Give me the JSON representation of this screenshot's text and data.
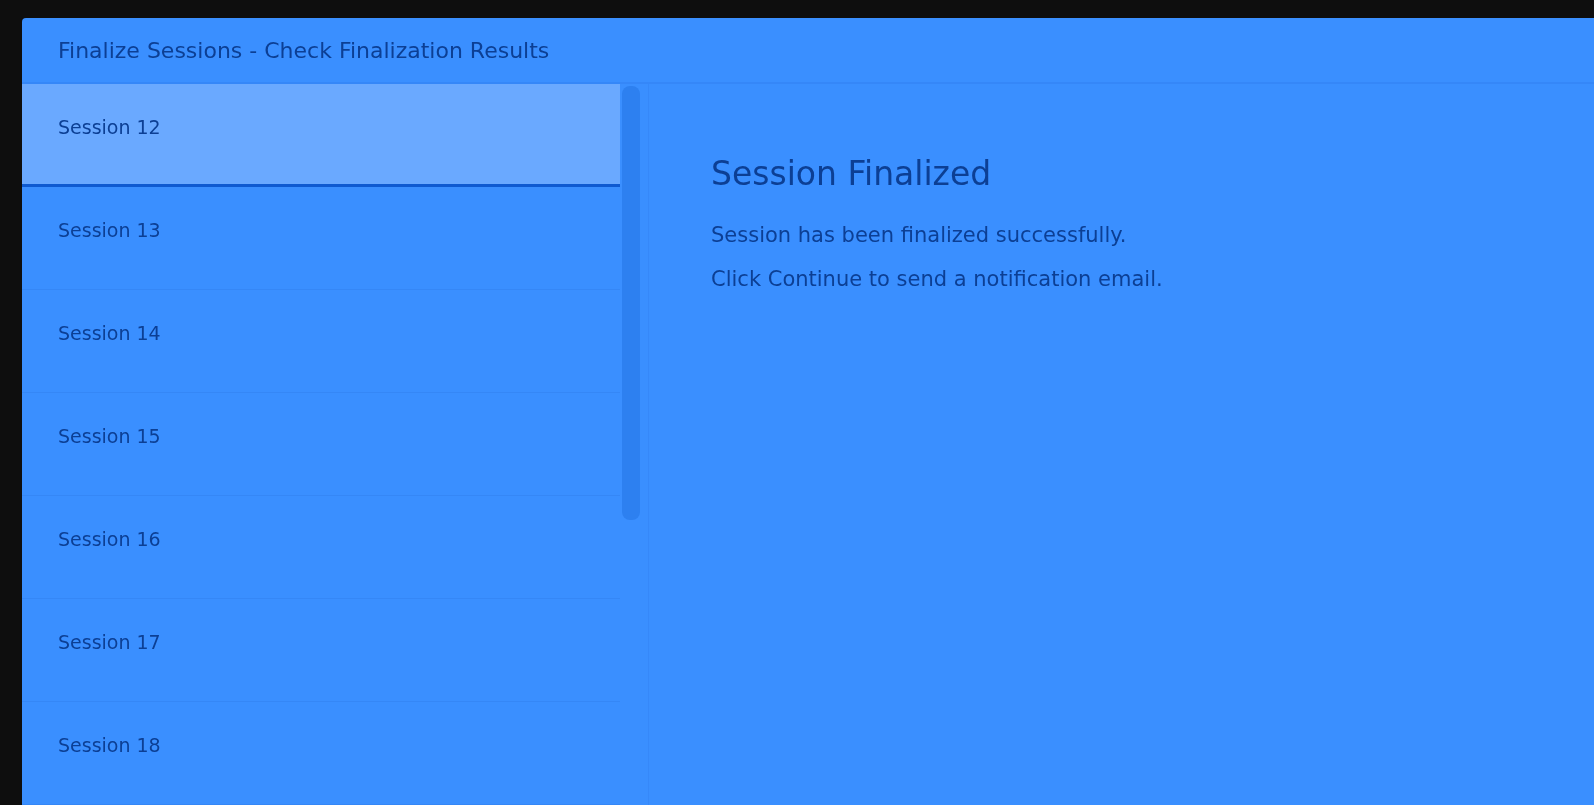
{
  "window": {
    "title": "Finalize Sessions - Check Finalization Results"
  },
  "sessions": [
    {
      "label": "Session 12",
      "selected": true
    },
    {
      "label": "Session 13",
      "selected": false
    },
    {
      "label": "Session 14",
      "selected": false
    },
    {
      "label": "Session 15",
      "selected": false
    },
    {
      "label": "Session 16",
      "selected": false
    },
    {
      "label": "Session 17",
      "selected": false
    },
    {
      "label": "Session 18",
      "selected": false
    }
  ],
  "detail": {
    "heading": "Session Finalized",
    "lines": [
      "Session has been finalized successfully.",
      "Click Continue to send a notification email."
    ]
  }
}
